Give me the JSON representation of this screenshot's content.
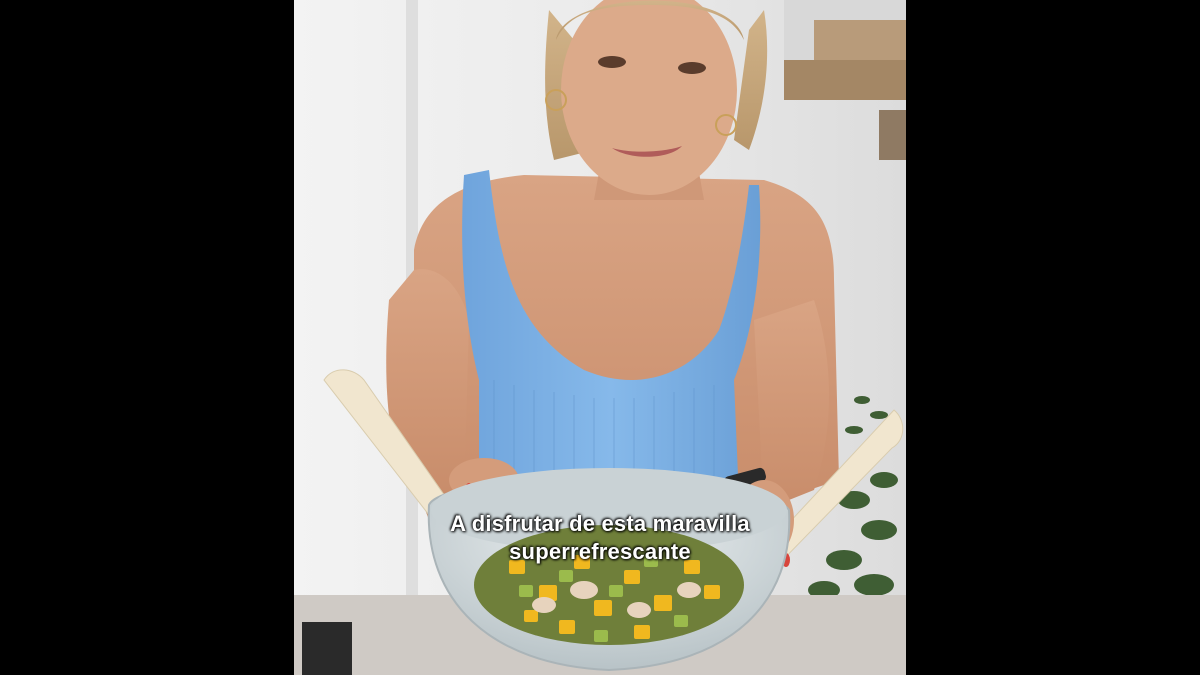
{
  "video": {
    "subtitle_line1": "A disfrutar de esta maravilla",
    "subtitle_line2": "superrefrescante"
  },
  "colors": {
    "letterbox": "#000000",
    "wall": "#ececec",
    "tank_top": "#7fb2e6",
    "bowl": "#d6dde0",
    "utensil": "#f1e6cf",
    "counter": "#cfcac5"
  }
}
